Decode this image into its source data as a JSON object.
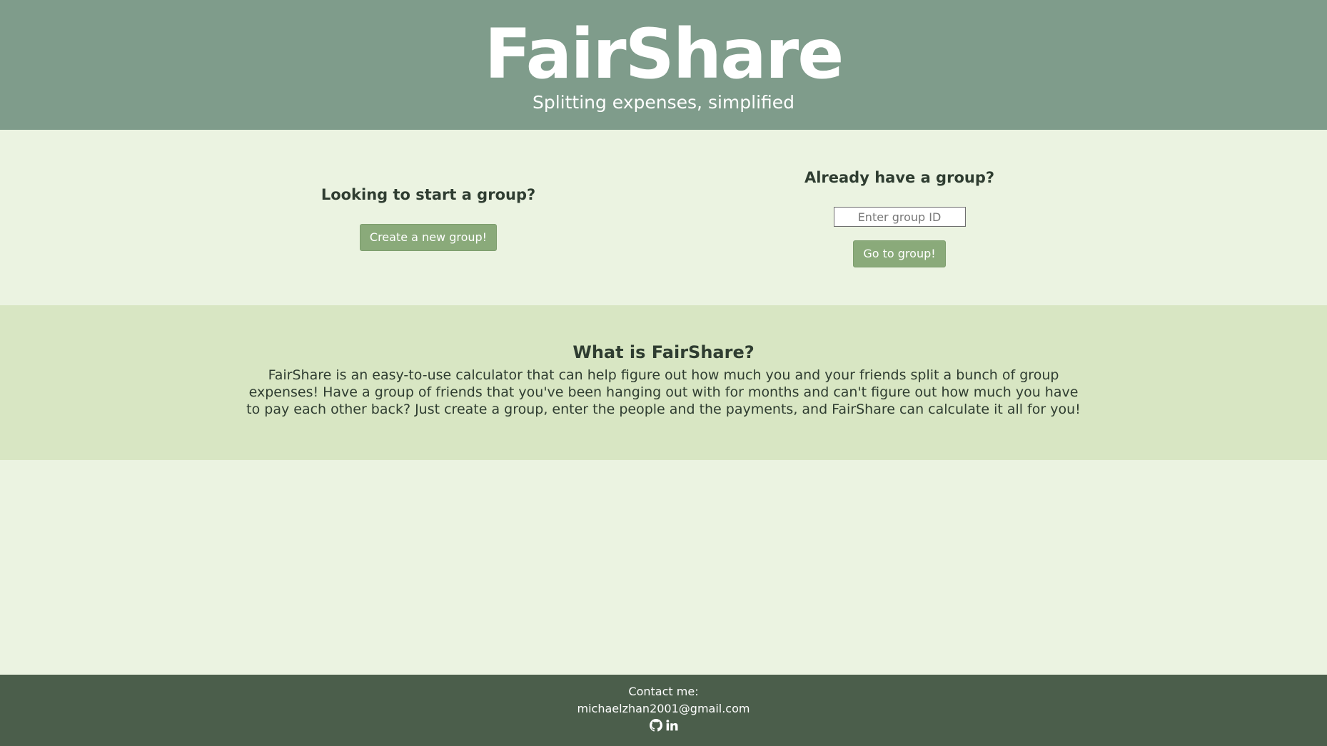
{
  "header": {
    "title": "FairShare",
    "subtitle": "Splitting expenses, simplified"
  },
  "start_group": {
    "heading": "Looking to start a group?",
    "button_label": "Create a new group!"
  },
  "join_group": {
    "heading": "Already have a group?",
    "input_placeholder": "Enter group ID",
    "input_value": "",
    "button_label": "Go to group!"
  },
  "about": {
    "heading": "What is FairShare?",
    "body": "FairShare is an easy-to-use calculator that can help figure out how much you and your friends split a bunch of group expenses! Have a group of friends that you've been hanging out with for months and can't figure out how much you have to pay each other back? Just create a group, enter the people and the payments, and FairShare can calculate it all for you!"
  },
  "footer": {
    "contact_label": "Contact me:",
    "email": "michaelzhan2001@gmail.com",
    "icons": [
      "github-icon",
      "linkedin-icon"
    ]
  },
  "colors": {
    "header_bg": "#7f9c8b",
    "page_bg": "#ebf3e1",
    "about_bg": "#d8e6c3",
    "footer_bg": "#4b5e4b",
    "button_bg": "#8aaa7a",
    "text": "#2f3d31"
  }
}
